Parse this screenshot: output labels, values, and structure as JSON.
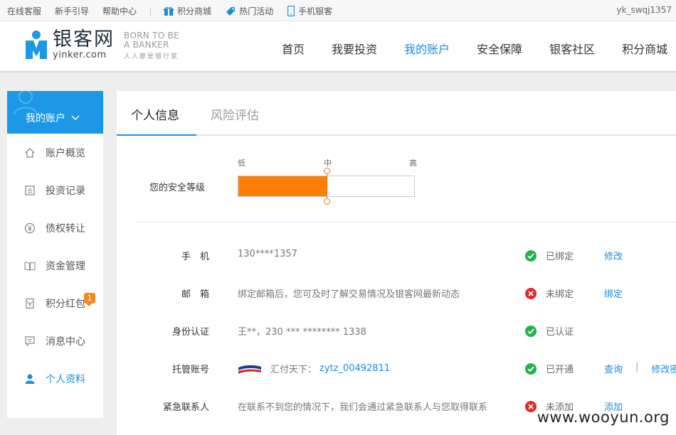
{
  "topbar": {
    "links": [
      "在线客服",
      "新手引导",
      "帮助中心"
    ],
    "features": [
      {
        "label": "积分商城",
        "icon": "gift-icon"
      },
      {
        "label": "热门活动",
        "icon": "tag-icon"
      },
      {
        "label": "手机银客",
        "icon": "phone-icon"
      }
    ],
    "username": "yk_swqj1357"
  },
  "header": {
    "logo_cn": "银客网",
    "logo_en": "yinker.com",
    "slogan_en_1": "BORN TO BE",
    "slogan_en_2": "A BANKER",
    "slogan_cn": "人人都是银行家",
    "nav": [
      "首页",
      "我要投资",
      "我的账户",
      "安全保障",
      "银客社区",
      "积分商城"
    ],
    "active_nav": "我的账户"
  },
  "sidebar": {
    "title": "我的账户",
    "items": [
      {
        "label": "账户概览",
        "icon": "home-icon",
        "active": false
      },
      {
        "label": "投资记录",
        "icon": "list-icon",
        "active": false
      },
      {
        "label": "债权转让",
        "icon": "yuan-coin-icon",
        "active": false
      },
      {
        "label": "资金管理",
        "icon": "book-icon",
        "active": false
      },
      {
        "label": "积分红包",
        "icon": "red-packet-icon",
        "active": false,
        "badge": "1"
      },
      {
        "label": "消息中心",
        "icon": "message-icon",
        "active": false
      },
      {
        "label": "个人资料",
        "icon": "user-icon",
        "active": true
      }
    ]
  },
  "main": {
    "tabs": [
      {
        "label": "个人信息",
        "active": true
      },
      {
        "label": "风险评估",
        "active": false
      }
    ],
    "security": {
      "label": "您的安全等级",
      "ticks": [
        "低",
        "中",
        "高"
      ],
      "level_fraction": 0.5,
      "fill_color": "#ff7e06"
    },
    "rows": [
      {
        "key": "手　机",
        "value": "130****1357",
        "status": "已绑定",
        "status_ok": true,
        "actions": [
          "修改"
        ]
      },
      {
        "key": "邮　箱",
        "value": "绑定邮箱后，您可及时了解交易情况及银客网最新动态",
        "status": "未绑定",
        "status_ok": false,
        "actions": [
          "绑定"
        ]
      },
      {
        "key": "身份认证",
        "value": "王**，230 *** ******** 1338",
        "status": "已认证",
        "status_ok": true,
        "actions": []
      },
      {
        "key": "托管账号",
        "value_prefix": "汇付天下：",
        "value_link": "zytz_00492811",
        "status": "已开通",
        "status_ok": true,
        "actions": [
          "查询",
          "修改密码"
        ]
      },
      {
        "key": "紧急联系人",
        "value": "在联系不到您的情况下，我们会通过紧急联系人与您取得联系",
        "status": "未添加",
        "status_ok": false,
        "actions": [
          "添加"
        ]
      }
    ]
  },
  "watermark": "www.wooyun.org",
  "colors": {
    "accent": "#1d8ce0",
    "ok": "#22b14c",
    "error": "#e02b2b",
    "orange": "#ff7e06"
  }
}
